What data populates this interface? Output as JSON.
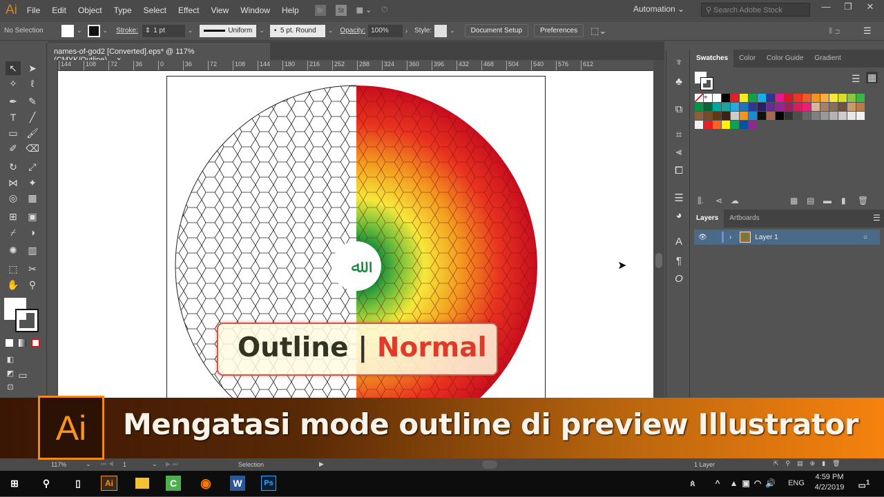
{
  "app": {
    "logo": "Ai",
    "menu": [
      "File",
      "Edit",
      "Object",
      "Type",
      "Select",
      "Effect",
      "View",
      "Window",
      "Help"
    ],
    "bridge": "Br",
    "stock": "St",
    "workspace": "Automation",
    "search_placeholder": "Search Adobe Stock",
    "window_controls": [
      "—",
      "❐",
      "✕"
    ]
  },
  "control": {
    "selection": "No Selection",
    "stroke_label": "Stroke:",
    "stroke_value": "1 pt",
    "profile": "Uniform",
    "brush": "5 pt. Round",
    "opacity_label": "Opacity:",
    "opacity_value": "100%",
    "style_label": "Style:",
    "document_setup": "Document Setup",
    "preferences": "Preferences"
  },
  "document": {
    "tab_title": "names-of-god2 [Converted].eps* @ 117% (CMYK/Outline)",
    "close": "×"
  },
  "ruler": {
    "ticks": [
      "144",
      "108",
      "72",
      "36",
      "0",
      "36",
      "72",
      "108",
      "144",
      "180",
      "216",
      "252",
      "288",
      "324",
      "360",
      "396",
      "432",
      "468",
      "504",
      "540",
      "576",
      "612"
    ]
  },
  "artwork": {
    "overlay_left": "Outline",
    "overlay_sep": "|",
    "overlay_right": "Normal",
    "left_color": "#333322",
    "right_color": "#e03a2a"
  },
  "panels": {
    "swatch_tabs": [
      "Swatches",
      "Color",
      "Color Guide",
      "Gradient"
    ],
    "layer_tabs": [
      "Layers",
      "Artboards"
    ],
    "layer_name": "Layer 1",
    "layer_count": "1 Layer",
    "swatches": [
      [
        "#ffffff",
        "#ffffff",
        "#ffffff",
        "#000000",
        "#e21e26",
        "#f6ea1b",
        "#12a04a",
        "#17aee8",
        "#2d3591",
        "#e9168c",
        "#d7182a",
        "#ee3524",
        "#f15a22",
        "#f7941d",
        "#fbae40",
        "#f5e83c",
        "#d7df23",
        "#8cc63f",
        "#39b54a"
      ],
      [
        "#009444",
        "#006838",
        "#00a79d",
        "#1ba39c",
        "#27aae1",
        "#1c75bc",
        "#2b3990",
        "#262262",
        "#662d91",
        "#92278f",
        "#9e1f63",
        "#d91c5c",
        "#ed1e79",
        "#d9b49c",
        "#a4826a",
        "#8b6e5a",
        "#6b5444",
        "#c69c6d",
        "#b57b4a"
      ],
      [
        "#8b5e3c",
        "#754c29",
        "#603913",
        "#3c2415",
        "#cccccc",
        "#f7931e",
        "#1c8bd0",
        "#111111",
        "#a66a4e",
        "#000000",
        "#333333",
        "#4d4d4d",
        "#666666",
        "#808080",
        "#999999",
        "#b3b3b3",
        "#cccccc",
        "#e6e6e6",
        "#f2f2f2"
      ],
      [
        "#f2f2f2",
        "#ed1c24",
        "#f26522",
        "#fff200",
        "#00a651",
        "#0054a6",
        "#92278f"
      ]
    ]
  },
  "status": {
    "zoom": "117%",
    "artboard": "1",
    "tool": "Selection"
  },
  "banner": {
    "logo": "Ai",
    "title": "Mengatasi mode outline di preview Illustrator"
  },
  "taskbar": {
    "apps": [
      "Ai",
      "Files",
      "C",
      "Firefox",
      "W",
      "Ps"
    ],
    "lang": "ENG",
    "time": "4:59 PM",
    "date": "4/2/2019",
    "notifications": "1"
  }
}
